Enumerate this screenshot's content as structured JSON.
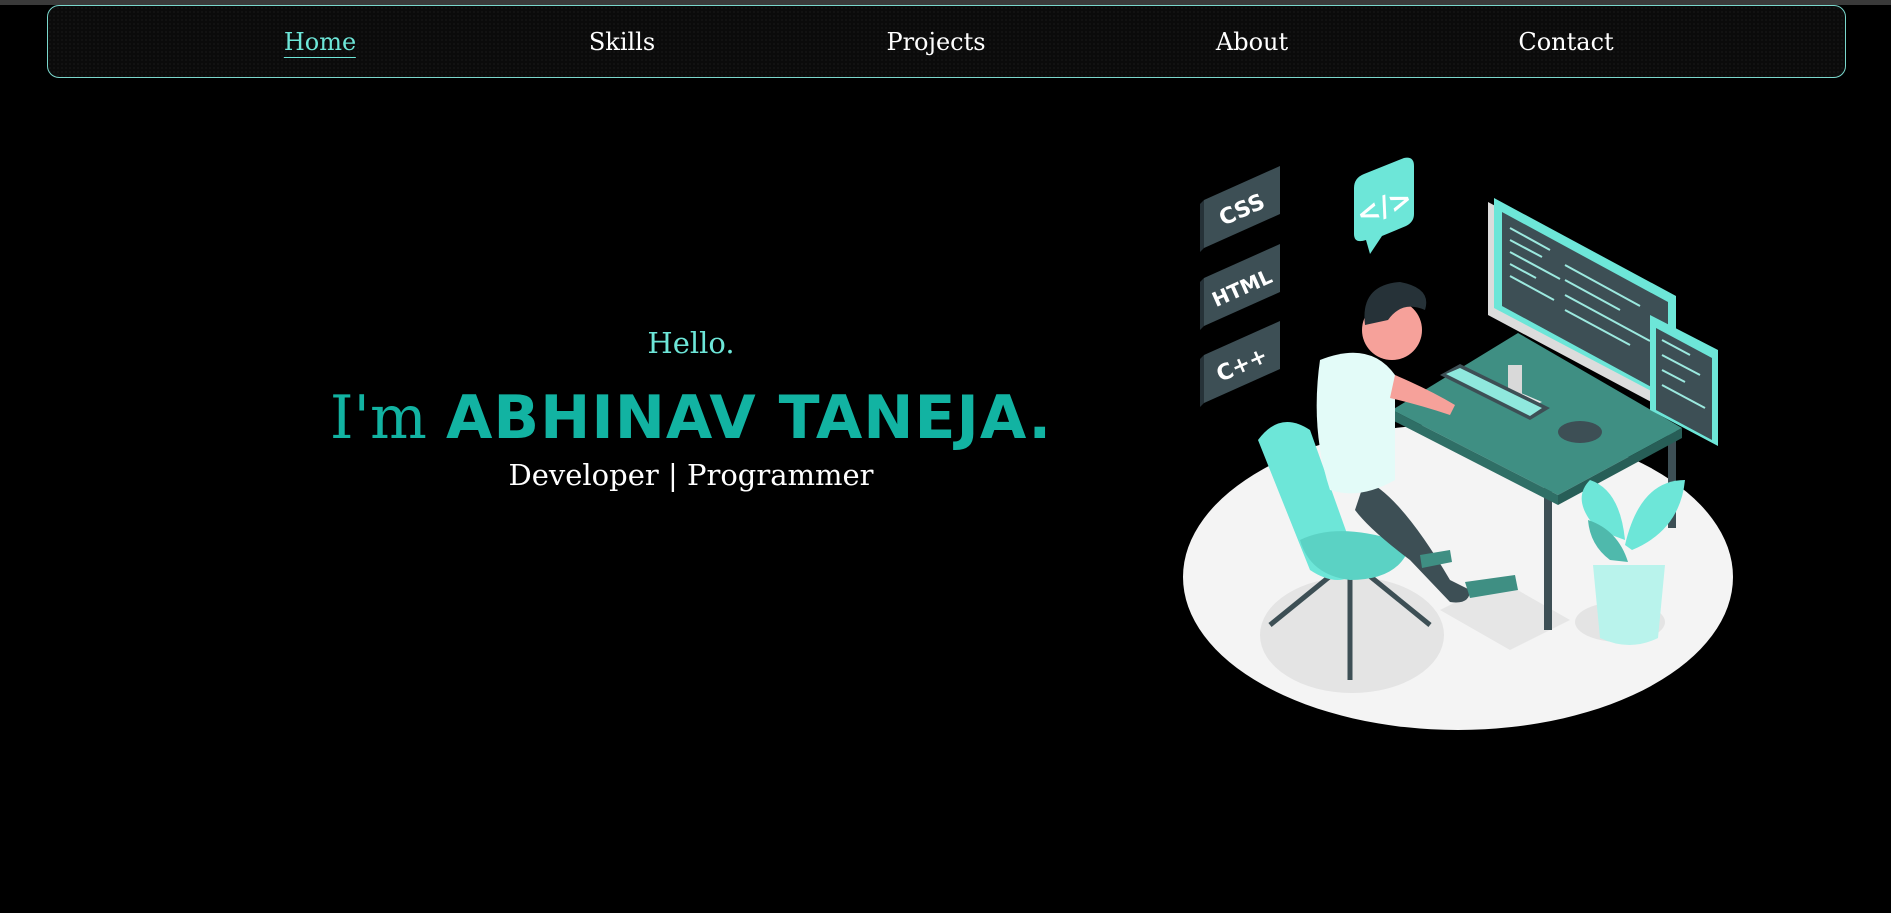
{
  "nav": {
    "items": [
      {
        "label": "Home",
        "active": true
      },
      {
        "label": "Skills",
        "active": false
      },
      {
        "label": "Projects",
        "active": false
      },
      {
        "label": "About",
        "active": false
      },
      {
        "label": "Contact",
        "active": false
      }
    ]
  },
  "hero": {
    "greeting": "Hello.",
    "intro": "I'm ",
    "name": "ABHINAV TANEJA.",
    "tagline": "Developer | Programmer"
  },
  "illustration": {
    "tiles": [
      "CSS",
      "HTML",
      "C++"
    ],
    "bubble": "</>"
  },
  "colors": {
    "accent": "#6de6d8",
    "accent_dark": "#12b3a2",
    "background": "#000000",
    "desk": "#3f8f83"
  }
}
